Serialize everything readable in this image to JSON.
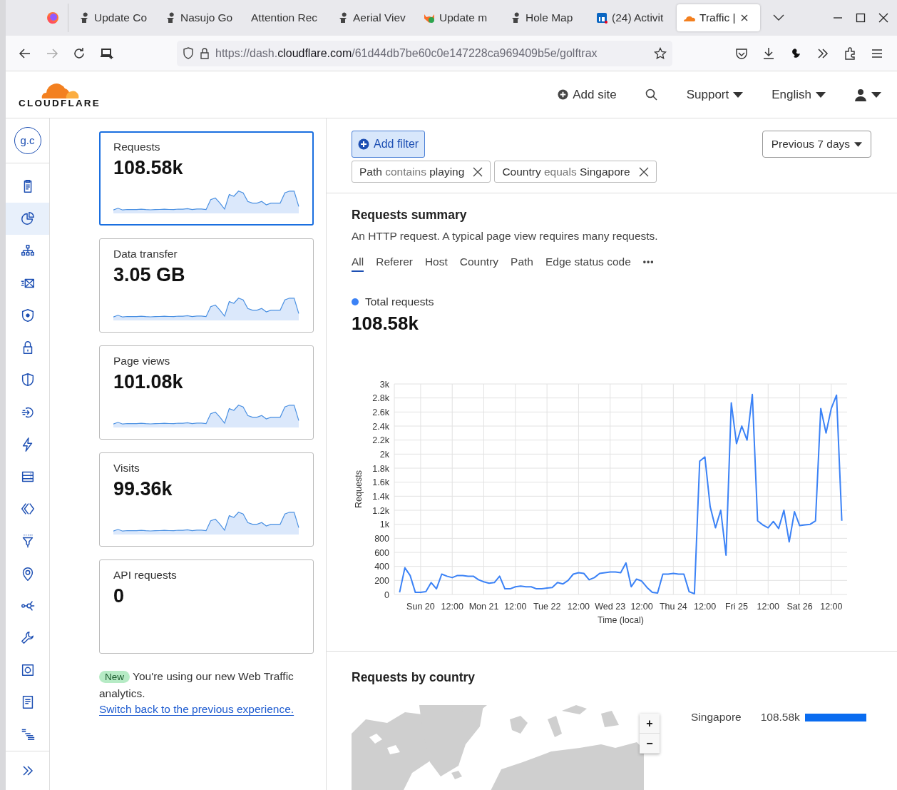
{
  "browser": {
    "tabs": [
      {
        "title": "Update Co",
        "selected": false
      },
      {
        "title": "Nasujo Go",
        "selected": false
      },
      {
        "title": "Attention Rec",
        "selected": false
      },
      {
        "title": "Aerial Viev",
        "selected": false
      },
      {
        "title": "Update m",
        "selected": false
      },
      {
        "title": "Hole Map",
        "selected": false
      },
      {
        "title": "(24) Activit",
        "selected": false
      },
      {
        "title": "Traffic |",
        "selected": true
      }
    ],
    "address": {
      "url_start": "https://dash.",
      "url_domain": "cloudflare.com",
      "url_rest": "/61d44db7be60c0e147228ca969409b5e/golftrax"
    }
  },
  "header": {
    "logo": "CLOUDFLARE",
    "add_site": "Add site",
    "menus": [
      {
        "label": "Support"
      },
      {
        "label": "English"
      }
    ]
  },
  "sidebar": {
    "avatar": "g.c",
    "items": [
      {
        "selected": false
      },
      {
        "selected": true
      },
      {
        "selected": false
      },
      {
        "selected": false
      },
      {
        "selected": false
      },
      {
        "selected": false
      },
      {
        "selected": false
      },
      {
        "selected": false
      },
      {
        "selected": false
      },
      {
        "selected": false
      },
      {
        "selected": false
      },
      {
        "selected": false
      },
      {
        "selected": false
      },
      {
        "selected": false
      },
      {
        "selected": false
      },
      {
        "selected": false
      },
      {
        "selected": false
      },
      {
        "selected": false
      }
    ]
  },
  "stats": [
    {
      "label": "Requests",
      "value": "108.58k",
      "selected": true,
      "trend": true
    },
    {
      "label": "Data transfer",
      "value": "3.05 GB",
      "selected": false,
      "trend": true
    },
    {
      "label": "Page views",
      "value": "101.08k",
      "selected": false,
      "trend": true
    },
    {
      "label": "Visits",
      "value": "99.36k",
      "selected": false,
      "trend": true
    },
    {
      "label": "API requests",
      "value": "0",
      "selected": false,
      "trend": false
    }
  ],
  "notice": {
    "badge": "New",
    "lines": [
      "You're using our new Web Traffic",
      "analytics."
    ],
    "link": "Switch back to the previous experience."
  },
  "filters": {
    "add_button": "Add filter",
    "chips": [
      {
        "field": "Path",
        "operator": "contains",
        "value": "playing"
      },
      {
        "field": "Country",
        "operator": "equals",
        "value": "Singapore"
      }
    ],
    "time_range": "Previous 7 days"
  },
  "summary": {
    "title": "Requests summary",
    "description": "An HTTP request. A typical page view requires many requests.",
    "tabs": [
      {
        "label": "All",
        "selected": true
      },
      {
        "label": "Referer",
        "selected": false
      },
      {
        "label": "Host",
        "selected": false
      },
      {
        "label": "Country",
        "selected": false
      },
      {
        "label": "Path",
        "selected": false
      },
      {
        "label": "Edge status code",
        "selected": false
      }
    ],
    "more": "•••",
    "legend": {
      "value": "108.58k"
    },
    "chart_data": {
      "type": "line",
      "xlabel": "Time (local)",
      "ylabel": "Requests",
      "categories": [
        null,
        null,
        null,
        null,
        "Sun 20",
        null,
        null,
        null,
        null,
        null,
        "12:00",
        null,
        null,
        null,
        null,
        null,
        "Mon 21",
        null,
        null,
        null,
        null,
        null,
        "12:00",
        null,
        null,
        null,
        null,
        null,
        "Tue 22",
        null,
        null,
        null,
        null,
        null,
        "12:00",
        null,
        null,
        null,
        null,
        null,
        "Wed 23",
        null,
        null,
        null,
        null,
        null,
        "12:00",
        null,
        null,
        null,
        null,
        null,
        "Thu 24",
        null,
        null,
        null,
        null,
        null,
        "12:00",
        null,
        null,
        null,
        null,
        null,
        "Fri 25",
        null,
        null,
        null,
        null,
        null,
        "12:00",
        null,
        null,
        null,
        null,
        null,
        "Sat 26",
        null,
        null,
        null,
        null,
        null,
        "12:00",
        null,
        null
      ],
      "series": [
        {
          "name": "Total requests",
          "color": "#3b82f6",
          "values": [
            30,
            380,
            270,
            30,
            30,
            40,
            170,
            80,
            290,
            260,
            240,
            270,
            270,
            260,
            260,
            210,
            180,
            160,
            170,
            260,
            80,
            80,
            110,
            120,
            110,
            110,
            80,
            80,
            90,
            100,
            170,
            150,
            200,
            290,
            310,
            300,
            210,
            240,
            300,
            310,
            320,
            320,
            310,
            450,
            110,
            220,
            190,
            100,
            30,
            20,
            290,
            290,
            300,
            290,
            290,
            40,
            10,
            1900,
            1960,
            1250,
            950,
            1200,
            560,
            2730,
            2150,
            2400,
            2200,
            2850,
            1050,
            990,
            950,
            1040,
            940,
            1200,
            750,
            1180,
            980,
            990,
            1000,
            1050,
            2650,
            2300,
            2650,
            2840,
            1050
          ]
        }
      ],
      "ylim": [
        0,
        3000
      ],
      "grid": true,
      "yticks": [
        0,
        200,
        400,
        600,
        800,
        {
          "value": 1000,
          "label": "1k"
        },
        {
          "value": 1200,
          "label": "1.2k"
        },
        {
          "value": 1400,
          "label": "1.4k"
        },
        {
          "value": 1600,
          "label": "1.6k"
        },
        {
          "value": 1800,
          "label": "1.8k"
        },
        {
          "value": 2000,
          "label": "2k"
        },
        {
          "value": 2200,
          "label": "2.2k"
        },
        {
          "value": 2400,
          "label": "2.4k"
        },
        {
          "value": 2600,
          "label": "2.6k"
        },
        {
          "value": 2800,
          "label": "2.8k"
        },
        {
          "value": 3000,
          "label": "3k"
        }
      ]
    }
  },
  "country": {
    "title": "Requests by country",
    "map": {
      "kind": "picture",
      "zoom_in": "+",
      "zoom_out": "−"
    },
    "rows": [
      {
        "country": "Singapore",
        "value": "108.58k",
        "level": 1
      }
    ]
  }
}
